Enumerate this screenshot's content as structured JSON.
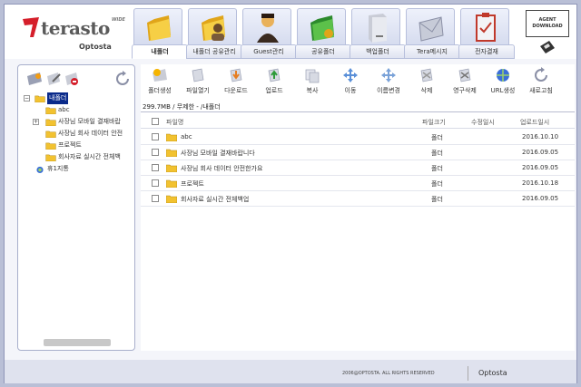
{
  "logo": {
    "name": "terasto",
    "wide": "WIDE",
    "sub": "Optosta"
  },
  "tabs": [
    {
      "label": "내폴더",
      "icon": "folder-icon",
      "active": true
    },
    {
      "label": "내폴더 공유관리",
      "icon": "shared-folder-icon",
      "active": false
    },
    {
      "label": "Guest관리",
      "icon": "guest-user-icon",
      "active": false
    },
    {
      "label": "공유폴더",
      "icon": "shared-folder-green-icon",
      "active": false
    },
    {
      "label": "백업폴더",
      "icon": "backup-drive-icon",
      "active": false
    },
    {
      "label": "Tera메시지",
      "icon": "envelope-icon",
      "active": false
    },
    {
      "label": "전자결재",
      "icon": "clipboard-icon",
      "active": false
    }
  ],
  "agent": {
    "line1": "AGENT",
    "line2": "DOWNLOAD"
  },
  "tree": {
    "root": "내폴더",
    "children": [
      "abc",
      "사장님 모바일 결재바랍",
      "사장님 회사 데이터 안전",
      "프로젝트",
      "회사자료 실시간 전체백"
    ],
    "other": "휴1지통"
  },
  "toolbar": [
    {
      "label": "폴더생성",
      "icon": "new-folder-icon"
    },
    {
      "label": "파일열기",
      "icon": "open-file-icon"
    },
    {
      "label": "다운로드",
      "icon": "download-icon"
    },
    {
      "label": "업로드",
      "icon": "upload-icon"
    },
    {
      "label": "복사",
      "icon": "copy-icon"
    },
    {
      "label": "이동",
      "icon": "move-icon"
    },
    {
      "label": "이름변경",
      "icon": "rename-icon"
    },
    {
      "label": "삭제",
      "icon": "delete-icon"
    },
    {
      "label": "영구삭제",
      "icon": "permanent-delete-icon"
    },
    {
      "label": "URL생성",
      "icon": "url-icon"
    },
    {
      "label": "새로고침",
      "icon": "refresh-icon"
    }
  ],
  "path": "299.7MB / 무제한 - /내폴더",
  "table": {
    "headers": {
      "name": "파일명",
      "size": "파일크기",
      "modified": "수정일시",
      "uploaded": "업로드일시"
    },
    "rows": [
      {
        "name": "abc",
        "size": "폴더",
        "uploaded": "2016.10.10"
      },
      {
        "name": "사장님 모바일 결재바랍니다",
        "size": "폴더",
        "uploaded": "2016.09.05"
      },
      {
        "name": "사장님 회사 데이터 안전한가요",
        "size": "폴더",
        "uploaded": "2016.09.05"
      },
      {
        "name": "프로젝트",
        "size": "폴더",
        "uploaded": "2016.10.18"
      },
      {
        "name": "회사자료 실시간 전체백업",
        "size": "폴더",
        "uploaded": "2016.09.05"
      }
    ]
  },
  "footer": {
    "copyright": "2006@OPTOSTA. ALL RIGHTS RESERVED",
    "brand": "Optosta"
  },
  "colors": {
    "accent": "#0a2a8a",
    "folder": "#f2c230",
    "logo_red": "#d51f2b"
  }
}
